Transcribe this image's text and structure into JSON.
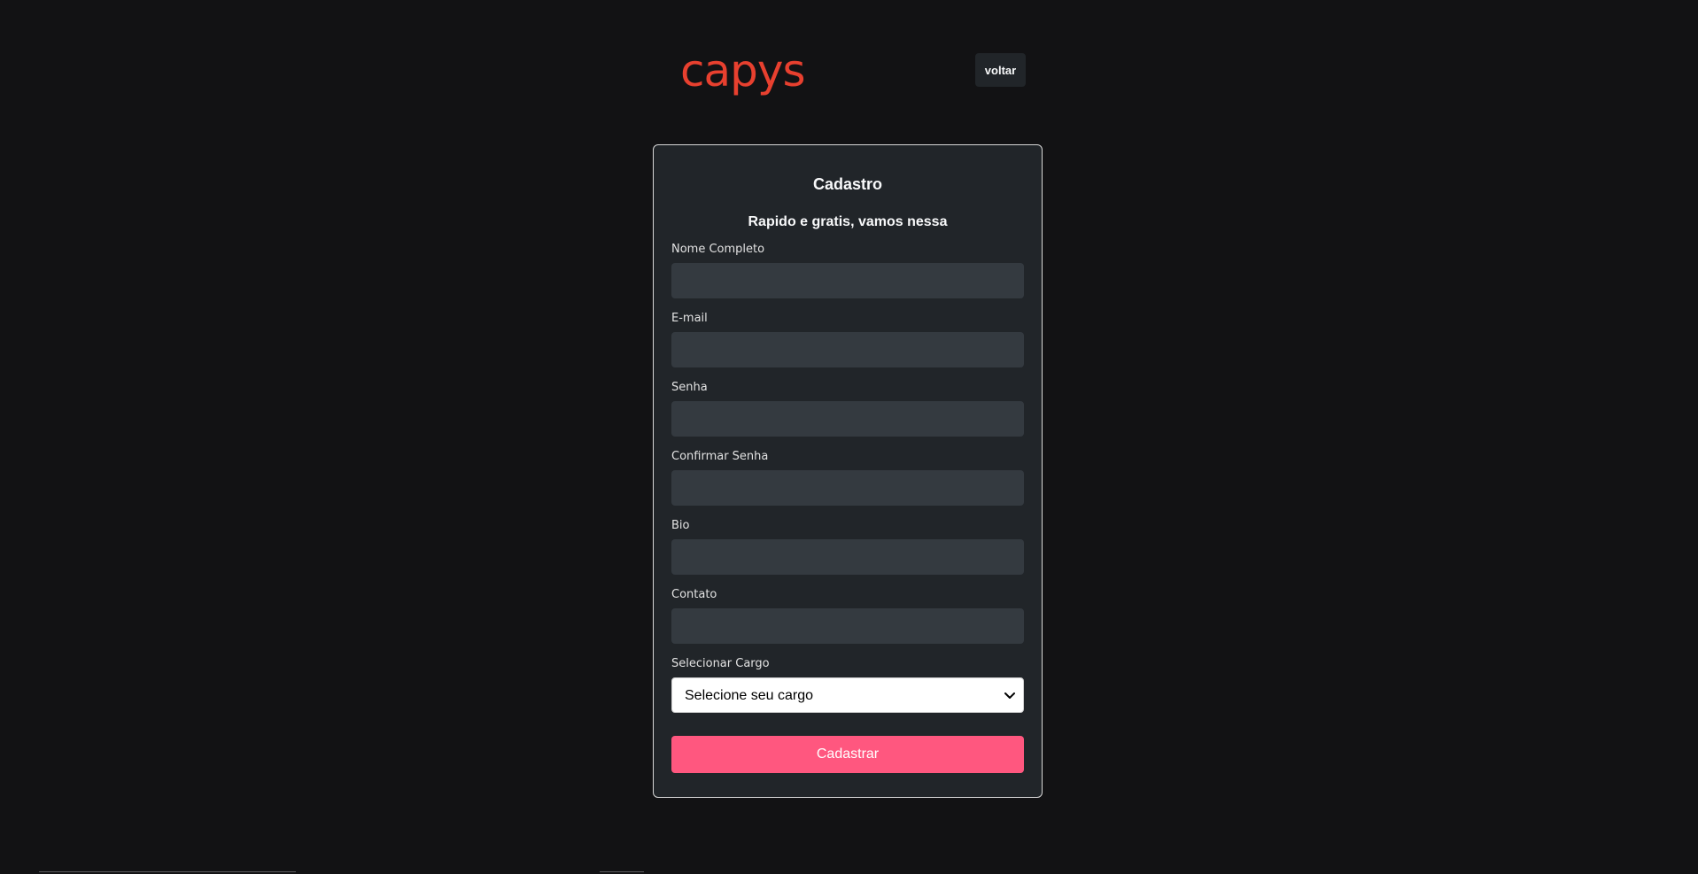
{
  "colors": {
    "background": "#121214",
    "card": "#212529",
    "input": "#343a40",
    "brand": "#e8402f",
    "primary": "#ff577f"
  },
  "header": {
    "logo_text": "capys",
    "back_label": "voltar"
  },
  "form": {
    "title": "Cadastro",
    "subtitle": "Rapido e gratis, vamos nessa",
    "fields": [
      {
        "label": "Nome Completo",
        "value": "",
        "placeholder": ""
      },
      {
        "label": "E-mail",
        "value": "",
        "placeholder": ""
      },
      {
        "label": "Senha",
        "value": "",
        "placeholder": ""
      },
      {
        "label": "Confirmar Senha",
        "value": "",
        "placeholder": ""
      },
      {
        "label": "Bio",
        "value": "",
        "placeholder": ""
      },
      {
        "label": "Contato",
        "value": "",
        "placeholder": ""
      }
    ],
    "select": {
      "label": "Selecionar Cargo",
      "selected": "Selecione seu cargo"
    },
    "submit_label": "Cadastrar"
  }
}
